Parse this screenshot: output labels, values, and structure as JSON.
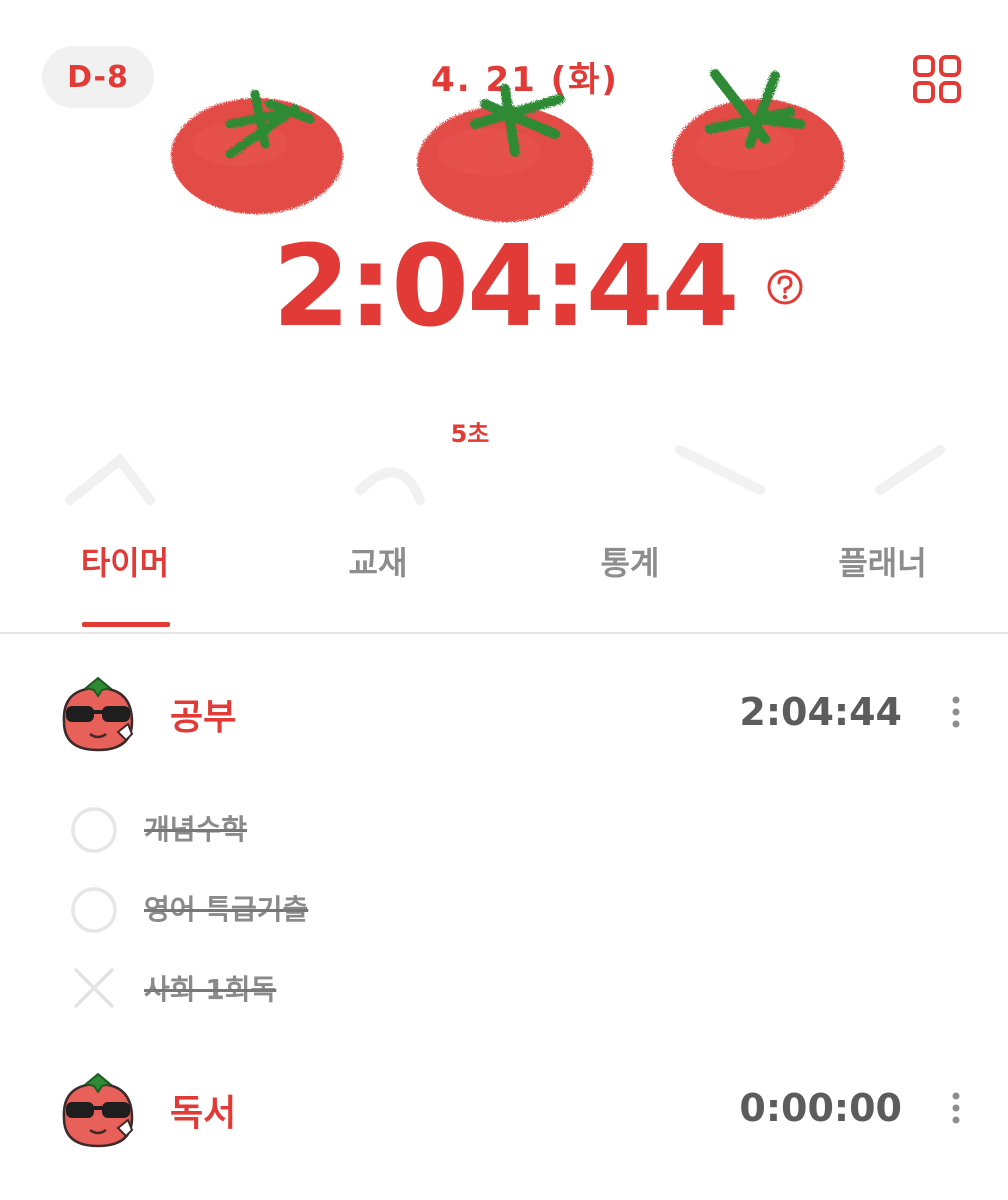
{
  "header": {
    "dday": "D-8",
    "date": "4. 21 (화)"
  },
  "timer": {
    "total": "2:04:44",
    "seconds_note": "5초"
  },
  "tabs": [
    {
      "label": "타이머",
      "active": true
    },
    {
      "label": "교재",
      "active": false
    },
    {
      "label": "통계",
      "active": false
    },
    {
      "label": "플래너",
      "active": false
    }
  ],
  "subjects": [
    {
      "name": "공부",
      "time": "2:04:44",
      "avatar": "tomato-sunglasses-icon",
      "tasks": [
        {
          "label": "개념수학",
          "status": "circle"
        },
        {
          "label": "영어 특급기출",
          "status": "circle"
        },
        {
          "label": "사회 1회독",
          "status": "x"
        }
      ]
    },
    {
      "name": "독서",
      "time": "0:00:00",
      "avatar": "tomato-sunglasses-icon",
      "tasks": []
    }
  ],
  "colors": {
    "accent": "#e23b37",
    "leaf": "#2f8a36",
    "text_gray": "#8a8a8a",
    "time_gray": "#5c5c5c"
  }
}
